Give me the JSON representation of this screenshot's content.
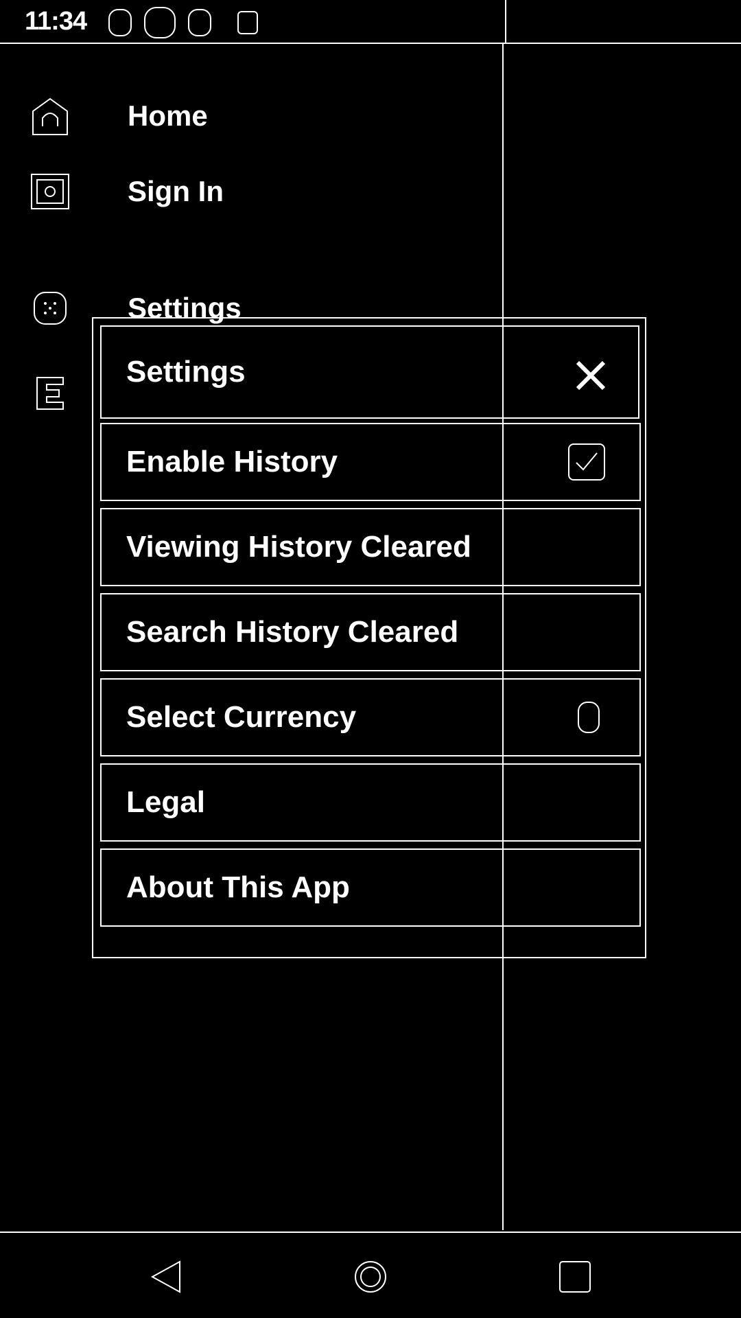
{
  "status_bar": {
    "time": "11:34",
    "icons": [
      "notification-icon",
      "app-icon",
      "app-icon-2",
      "battery-icon"
    ]
  },
  "drawer": {
    "items": [
      {
        "label": "Home",
        "icon": "home-icon"
      },
      {
        "label": "Sign In",
        "icon": "sign-in-icon"
      },
      {
        "label": "Settings",
        "icon": "settings-icon"
      },
      {
        "label": "",
        "icon": "e-icon"
      }
    ]
  },
  "dialog": {
    "title": "Settings",
    "close_icon": "close-icon",
    "rows": [
      {
        "label": "Enable History",
        "control": "checkbox",
        "checked": true
      },
      {
        "label": "Viewing History Cleared"
      },
      {
        "label": "Search History Cleared"
      },
      {
        "label": "Select Currency",
        "control": "indicator"
      },
      {
        "label": "Legal"
      },
      {
        "label": "About This App"
      }
    ]
  },
  "nav_bar": {
    "buttons": [
      "back-icon",
      "home-nav-icon",
      "recents-icon"
    ]
  }
}
